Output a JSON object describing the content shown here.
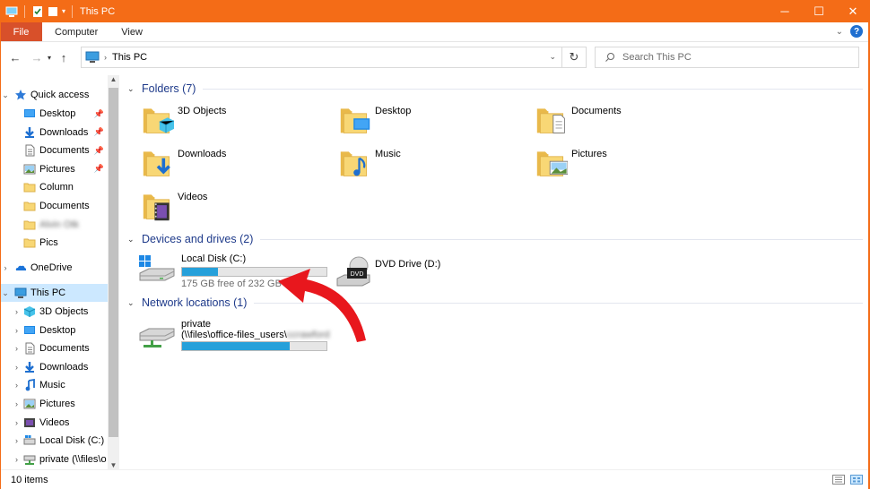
{
  "window": {
    "title": "This PC"
  },
  "ribbon": {
    "file": "File",
    "tabs": [
      "Computer",
      "View"
    ],
    "help": "?"
  },
  "address": {
    "crumb": "This PC"
  },
  "search": {
    "placeholder": "Search This PC"
  },
  "nav": {
    "quick_access": "Quick access",
    "quick_items": [
      {
        "label": "Desktop",
        "icon": "desktop-icon",
        "pinned": true
      },
      {
        "label": "Downloads",
        "icon": "downloads-icon",
        "pinned": true
      },
      {
        "label": "Documents",
        "icon": "documents-icon",
        "pinned": true
      },
      {
        "label": "Pictures",
        "icon": "pictures-icon",
        "pinned": true
      },
      {
        "label": "Column",
        "icon": "folder-icon",
        "pinned": false
      },
      {
        "label": "Documents",
        "icon": "folder-icon",
        "pinned": false
      },
      {
        "label": "Alvin Otk",
        "icon": "folder-icon",
        "pinned": false,
        "blurred": true
      },
      {
        "label": "Pics",
        "icon": "folder-icon",
        "pinned": false
      }
    ],
    "onedrive": "OneDrive",
    "this_pc": "This PC",
    "pc_items": [
      {
        "label": "3D Objects",
        "icon": "3d-objects-icon"
      },
      {
        "label": "Desktop",
        "icon": "desktop-icon"
      },
      {
        "label": "Documents",
        "icon": "documents-icon"
      },
      {
        "label": "Downloads",
        "icon": "downloads-icon"
      },
      {
        "label": "Music",
        "icon": "music-icon"
      },
      {
        "label": "Pictures",
        "icon": "pictures-icon"
      },
      {
        "label": "Videos",
        "icon": "videos-icon"
      },
      {
        "label": "Local Disk (C:)",
        "icon": "local-disk-icon"
      },
      {
        "label": "private (\\\\files\\o",
        "icon": "network-drive-icon"
      }
    ]
  },
  "content": {
    "folders_header": "Folders (7)",
    "folders": [
      {
        "label": "3D Objects",
        "icon": "3d-objects-icon"
      },
      {
        "label": "Desktop",
        "icon": "desktop-icon"
      },
      {
        "label": "Documents",
        "icon": "documents-icon"
      },
      {
        "label": "Downloads",
        "icon": "downloads-icon"
      },
      {
        "label": "Music",
        "icon": "music-icon"
      },
      {
        "label": "Pictures",
        "icon": "pictures-icon"
      },
      {
        "label": "Videos",
        "icon": "videos-icon"
      }
    ],
    "devices_header": "Devices and drives (2)",
    "local_disk": {
      "label": "Local Disk (C:)",
      "free": "175 GB free of 232 GB",
      "used_fraction": 0.246
    },
    "dvd": {
      "label": "DVD Drive (D:)",
      "badge": "DVD"
    },
    "network_header": "Network locations (1)",
    "network": {
      "label": "private",
      "path": "(\\\\files\\office-files_users\\",
      "path_blurred": "ccrawford",
      "used_fraction": 0.745
    }
  },
  "status": {
    "items": "10 items"
  },
  "colors": {
    "titlebar": "#f46c17",
    "file_tab": "#d8502a",
    "bar_fill": "#26a0da",
    "header_text": "#1e3a8a"
  }
}
